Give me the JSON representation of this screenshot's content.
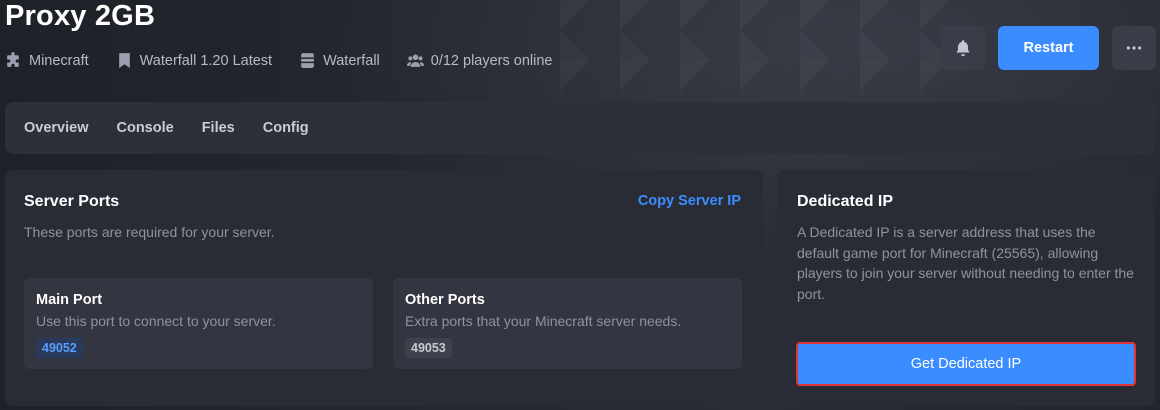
{
  "header": {
    "title": "Proxy 2GB",
    "meta": [
      {
        "icon": "puzzle-icon",
        "label": "Minecraft"
      },
      {
        "icon": "bookmark-icon",
        "label": "Waterfall 1.20 Latest"
      },
      {
        "icon": "server-icon",
        "label": "Waterfall"
      },
      {
        "icon": "users-icon",
        "label": "0/12 players online"
      }
    ],
    "restart_label": "Restart"
  },
  "nav": {
    "tabs": [
      "Overview",
      "Console",
      "Files",
      "Config"
    ]
  },
  "server_ports": {
    "title": "Server Ports",
    "subtitle": "These ports are required for your server.",
    "copy_label": "Copy Server IP",
    "main_port": {
      "title": "Main Port",
      "description": "Use this port to connect to your server.",
      "value": "49052"
    },
    "other_ports": {
      "title": "Other Ports",
      "description": "Extra ports that your Minecraft server needs.",
      "value": "49053"
    }
  },
  "dedicated_ip": {
    "title": "Dedicated IP",
    "description": "A Dedicated IP is a server address that uses the default game port for Minecraft (25565), allowing players to join your server without needing to enter the port.",
    "button_label": "Get Dedicated IP"
  },
  "colors": {
    "accent": "#3b8cff",
    "highlight_border": "#e03434",
    "card_bg": "#2a2c35"
  }
}
